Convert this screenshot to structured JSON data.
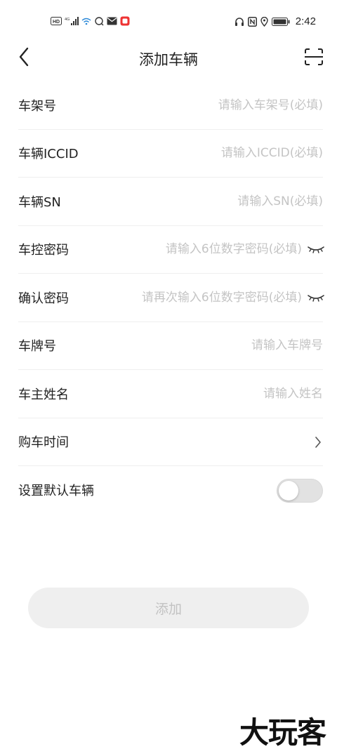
{
  "status_bar": {
    "time": "2:42",
    "left_icons": [
      "hd-icon",
      "4g-signal-icon",
      "wifi-hotspot-icon",
      "app-icon",
      "mail-icon",
      "app-red-icon"
    ],
    "right_icons": [
      "headset-icon",
      "nfc-icon",
      "location-icon",
      "battery-icon"
    ]
  },
  "header": {
    "title": "添加车辆",
    "back_icon": "chevron-left-icon",
    "scan_icon": "scan-icon"
  },
  "form": {
    "vin": {
      "label": "车架号",
      "placeholder": "请输入车架号(必填)"
    },
    "iccid": {
      "label": "车辆ICCID",
      "placeholder": "请输入ICCID(必填)"
    },
    "sn": {
      "label": "车辆SN",
      "placeholder": "请输入SN(必填)"
    },
    "password": {
      "label": "车控密码",
      "placeholder": "请输入6位数字密码(必填)"
    },
    "confirm_password": {
      "label": "确认密码",
      "placeholder": "请再次输入6位数字密码(必填)"
    },
    "plate": {
      "label": "车牌号",
      "placeholder": "请输入车牌号"
    },
    "owner": {
      "label": "车主姓名",
      "placeholder": "请输入姓名"
    },
    "purchase_date": {
      "label": "购车时间"
    },
    "default_vehicle": {
      "label": "设置默认车辆",
      "enabled": false
    }
  },
  "submit": {
    "label": "添加"
  },
  "watermark": "大玩客",
  "colors": {
    "placeholder": "#c4c4c4",
    "divider": "#efefef",
    "button_bg": "#efefef",
    "button_text": "#c2c2c2"
  }
}
